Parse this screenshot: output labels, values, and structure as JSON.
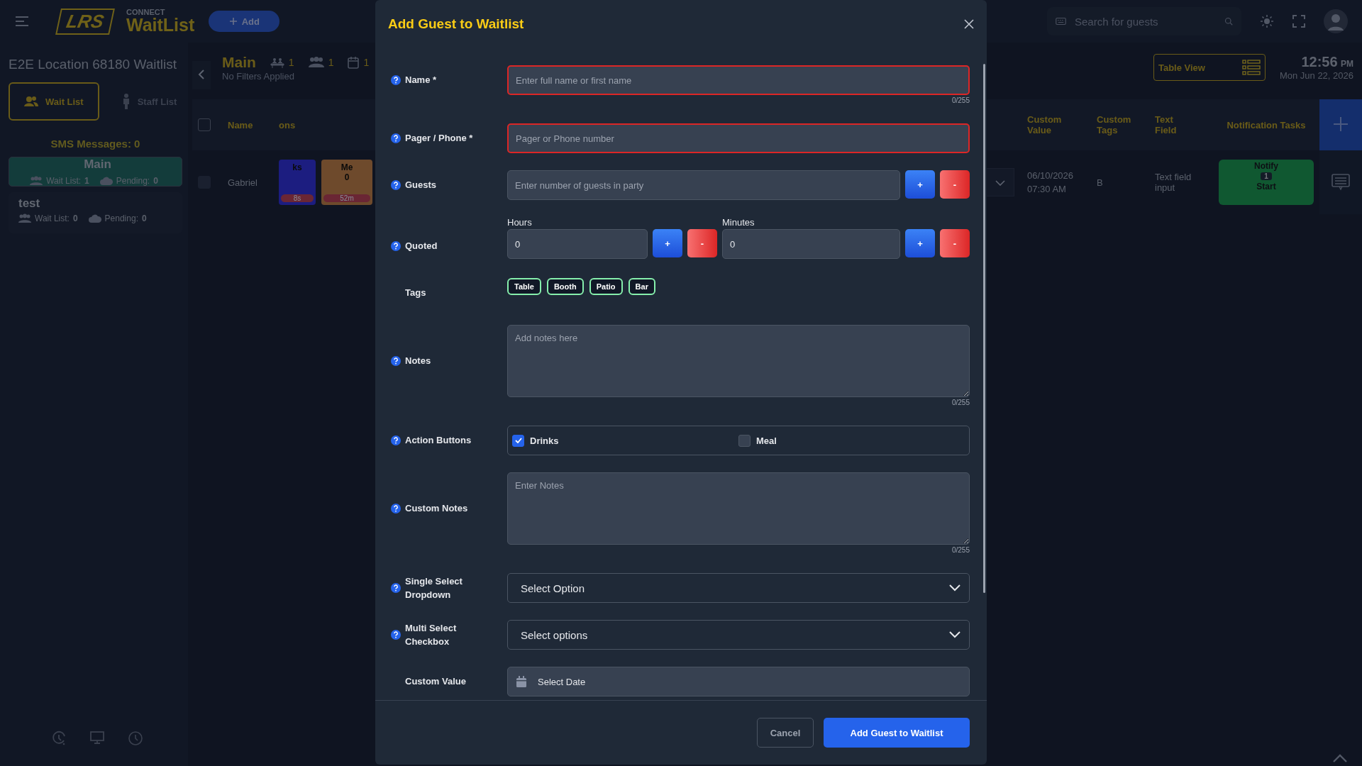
{
  "header": {
    "logo": "LRS",
    "brand_top": "CONNECT",
    "brand": "WaitList",
    "add_button": "Add",
    "search": {
      "placeholder": "Search for guests"
    }
  },
  "sidebar": {
    "location": "E2E Location 68180 Waitlist",
    "tabs": [
      {
        "label": "Wait List",
        "selected": true
      },
      {
        "label": "Staff List",
        "selected": false
      }
    ],
    "sms": "SMS Messages: 0",
    "lists": [
      {
        "name": "Main",
        "selected": true,
        "wait_label": "Wait List:",
        "wait": "1",
        "pending_label": "Pending:",
        "pending": "0"
      },
      {
        "name": "test",
        "selected": false,
        "wait_label": "Wait List:",
        "wait": "0",
        "pending_label": "Pending:",
        "pending": "0"
      }
    ]
  },
  "main": {
    "title": "Main",
    "counts": [
      {
        "kind": "seated",
        "value": "1"
      },
      {
        "kind": "party",
        "value": "1"
      },
      {
        "kind": "calendar",
        "value": "1"
      }
    ],
    "filters": "No Filters Applied",
    "view_button": "Table View",
    "time": "12:56",
    "ampm": "PM",
    "date": "Mon Jun 22, 2026"
  },
  "table": {
    "all_checked": false,
    "columns_left": [
      "Name",
      "ons"
    ],
    "columns_right": [
      "Custom Value",
      "Custom Tags",
      "Text Field",
      "Notification Tasks"
    ],
    "rows": [
      {
        "name": "Gabriel",
        "checked": false,
        "cards": [
          {
            "lines": [
              "ks"
            ],
            "timer": "8s",
            "color": "#1c1d80"
          },
          {
            "lines": [
              "Me",
              "0"
            ],
            "timer": "52m",
            "color": "#6e4a2c"
          }
        ],
        "custom_value": [
          "06/10/2026",
          "07:30 AM"
        ],
        "custom_tags": "B",
        "text_field": "Text field input",
        "notify": {
          "title": "Notify",
          "count": "1",
          "action": "Start"
        }
      }
    ]
  },
  "modal": {
    "title": "Add Guest to Waitlist",
    "fields": [
      {
        "kind": "text",
        "label": "Name *",
        "help": true,
        "placeholder": "Enter full name or first name",
        "error": true,
        "counter": "0/255"
      },
      {
        "kind": "text",
        "label": "Pager / Phone *",
        "help": true,
        "placeholder": "Pager or Phone number",
        "error": true
      },
      {
        "kind": "stepper",
        "label": "Guests",
        "help": true,
        "placeholder": "Enter number of guests in party",
        "increment": "+",
        "decrement": "-"
      },
      {
        "kind": "quoted",
        "label": "Quoted",
        "help": true,
        "parts": [
          {
            "label": "Hours",
            "value": "0",
            "increment": "+",
            "decrement": "-"
          },
          {
            "label": "Minutes",
            "value": "0",
            "increment": "+",
            "decrement": "-"
          }
        ]
      },
      {
        "kind": "tags",
        "label": "Tags",
        "help": false,
        "tags": [
          "Table",
          "Booth",
          "Patio",
          "Bar"
        ]
      },
      {
        "kind": "textarea",
        "label": "Notes",
        "help": true,
        "placeholder": "Add notes here",
        "counter": "0/255"
      },
      {
        "kind": "checks",
        "label": "Action Buttons",
        "help": true,
        "options": [
          {
            "label": "Drinks",
            "checked": true
          },
          {
            "label": "Meal",
            "checked": false
          }
        ]
      },
      {
        "kind": "textarea",
        "label": "Custom Notes",
        "help": true,
        "placeholder": "Enter Notes",
        "counter": "0/255"
      },
      {
        "kind": "select",
        "label": "Single Select Dropdown",
        "help": true,
        "value": "Select Option"
      },
      {
        "kind": "select",
        "label": "Multi Select Checkbox",
        "help": true,
        "value": "Select options"
      },
      {
        "kind": "date",
        "label": "Custom Value",
        "help": false,
        "placeholder": "Select Date"
      }
    ],
    "buttons": [
      {
        "label": "Cancel",
        "kind": "secondary"
      },
      {
        "label": "Add Guest to Waitlist",
        "kind": "primary"
      }
    ]
  }
}
